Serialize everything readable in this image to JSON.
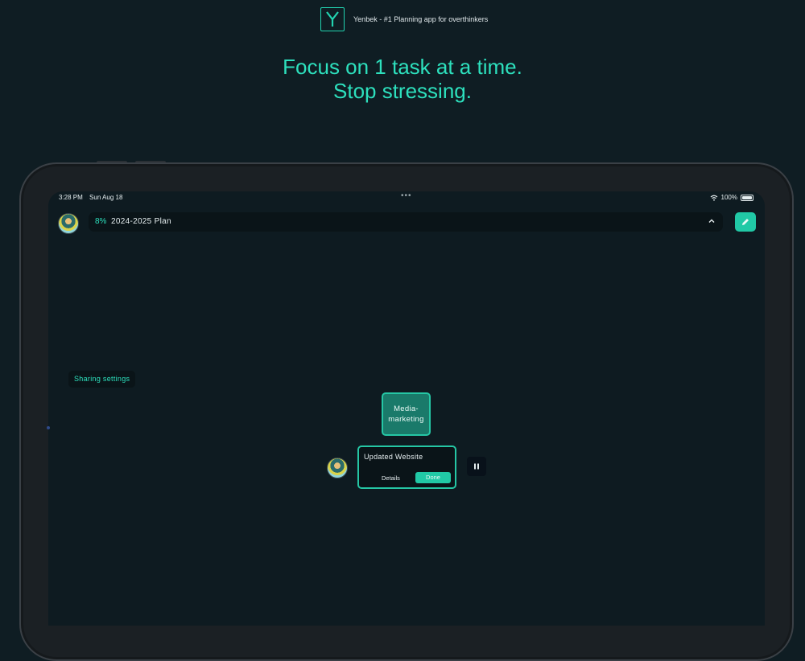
{
  "app": {
    "title": "Yenbek - #1 Planning app for overthinkers",
    "logo_letter": "Y"
  },
  "headline": {
    "line1": "Focus on 1 task at a time.",
    "line2": "Stop stressing."
  },
  "status_bar": {
    "time": "3:28 PM",
    "date": "Sun Aug 18",
    "dots": "•••",
    "battery": "100%"
  },
  "plan": {
    "percent": "8%",
    "name": "2024-2025 Plan"
  },
  "sharing_label": "Sharing settings",
  "nodes": {
    "media": "Media-\nmarketing",
    "task_title": "Updated Website",
    "details_label": "Details",
    "done_label": "Done"
  },
  "icons": {
    "edit": "pencil-icon",
    "chevron": "chevron-up-icon",
    "pause": "pause-icon",
    "wifi": "wifi-icon",
    "battery": "battery-icon"
  },
  "colors": {
    "accent": "#2de0bd",
    "button": "#21c9a6",
    "background": "#0f1d23"
  }
}
